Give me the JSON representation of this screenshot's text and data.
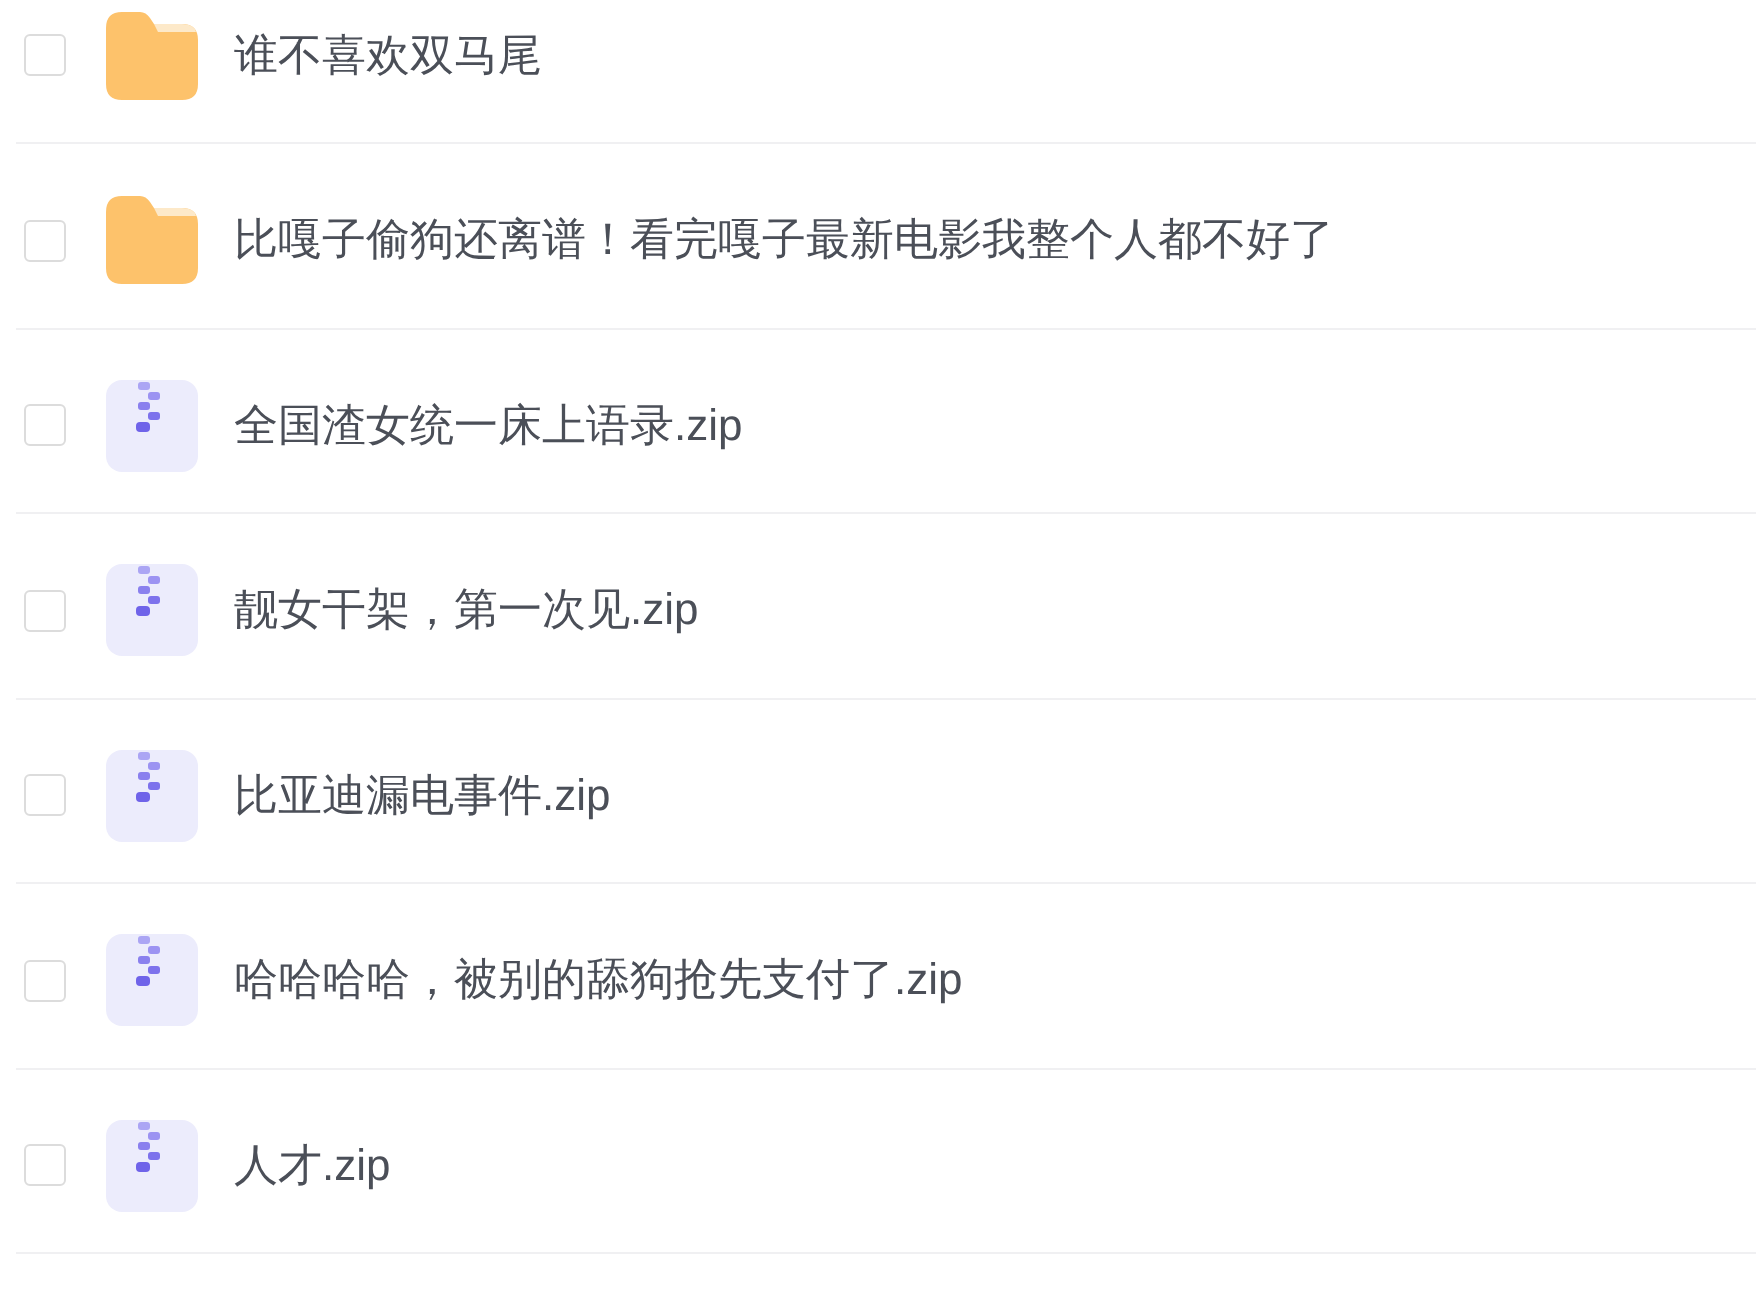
{
  "files": [
    {
      "kind": "folder",
      "name": "谁不喜欢双马尾",
      "checked": false
    },
    {
      "kind": "folder",
      "name": "比嘎子偷狗还离谱！看完嘎子最新电影我整个人都不好了",
      "checked": false
    },
    {
      "kind": "zip",
      "name": "全国渣女统一床上语录.zip",
      "checked": false
    },
    {
      "kind": "zip",
      "name": "靓女干架，第一次见.zip",
      "checked": false
    },
    {
      "kind": "zip",
      "name": "比亚迪漏电事件.zip",
      "checked": false
    },
    {
      "kind": "zip",
      "name": "哈哈哈哈，被别的舔狗抢先支付了.zip",
      "checked": false
    },
    {
      "kind": "zip",
      "name": "人才.zip",
      "checked": false
    }
  ]
}
